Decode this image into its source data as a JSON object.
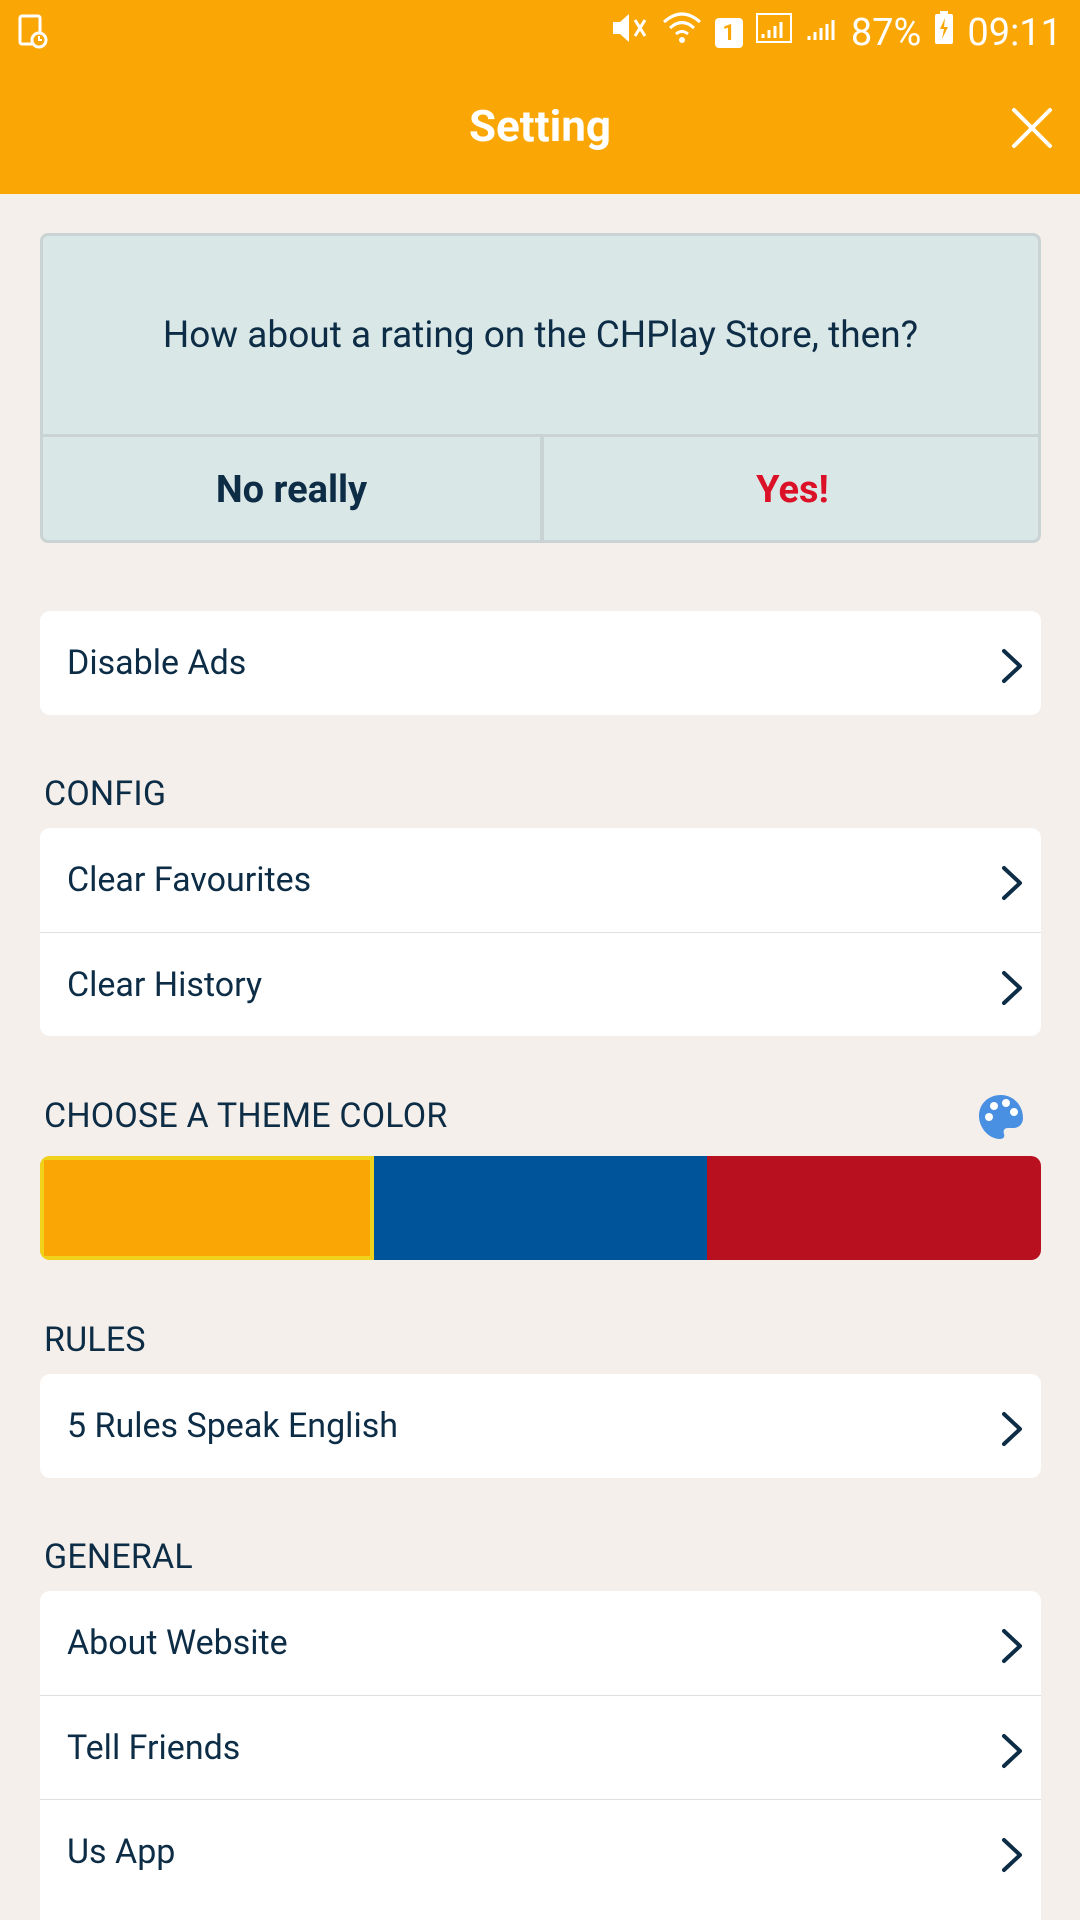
{
  "status_bar": {
    "battery_percent": "87%",
    "time": "09:11",
    "sim_badge": "1"
  },
  "header": {
    "title": "Setting"
  },
  "rating": {
    "question": "How about a rating on the CHPlay Store, then?",
    "no_label": "No really",
    "yes_label": "Yes!"
  },
  "ads": {
    "items": [
      {
        "label": "Disable Ads"
      }
    ]
  },
  "config": {
    "label": "CONFIG",
    "items": [
      {
        "label": "Clear Favourites"
      },
      {
        "label": "Clear History"
      }
    ]
  },
  "theme": {
    "label": "CHOOSE A THEME COLOR",
    "colors": [
      "#faa705",
      "#005499",
      "#b8101f"
    ],
    "selected_index": 0
  },
  "rules": {
    "label": "RULES",
    "items": [
      {
        "label": "5 Rules Speak English"
      }
    ]
  },
  "general": {
    "label": "GENERAL",
    "items": [
      {
        "label": "About Website"
      },
      {
        "label": "Tell Friends"
      },
      {
        "label": "Us App"
      }
    ]
  }
}
